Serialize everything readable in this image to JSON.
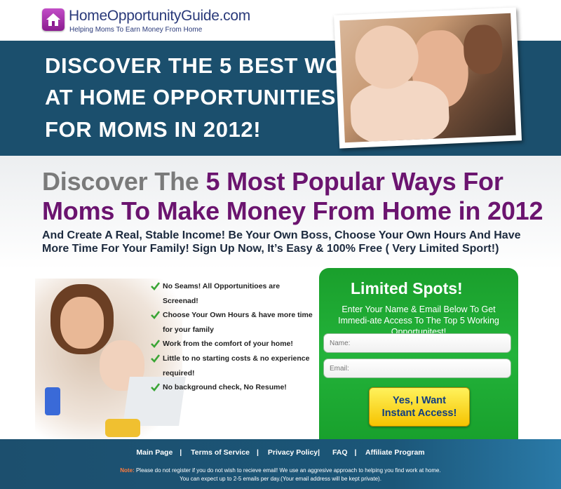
{
  "header": {
    "logo_name": "HomeOpportunityGuide",
    "logo_domain": ".com",
    "tagline": "Helping Moms To Earn Money From Home",
    "icon": "house-icon"
  },
  "hero": {
    "line1": "DISCOVER THE 5 BEST WORK",
    "line2": "AT HOME OPPORTUNITIES",
    "line3": "FOR MOMS IN 2012!"
  },
  "main": {
    "headline_gray": "Discover The ",
    "headline_purple": "5 Most Popular Ways For",
    "headline2": "Moms To Make Money From Home in 2012",
    "subhead": "And Create A Real, Stable Income! Be Your Own Boss, Choose Your Own Hours And Have More Time For Your Family! Sign Up Now, It’s Easy & 100% Free ( Very Limited Sport!)",
    "benefits": [
      "No Seams! All Opportunitioes are Screenad!",
      "Choose Your Own Hours & have more time for your family",
      "Work from the comfort of your home!",
      "Little to no starting costs & no experience required!",
      "No background check, No Resume!"
    ]
  },
  "form": {
    "title": "Limited Spots!",
    "description": "Enter Your Name & Email Below To Get Immedi-ate Access To The Top 5 Working Opportunitest!",
    "name_placeholder": "Name:",
    "email_placeholder": "Email:",
    "cta_line1": "Yes, I Want",
    "cta_line2": "Instant Access!"
  },
  "footer": {
    "links": [
      "Main Page",
      "Terms of Service",
      "Privacy Policy|",
      "FAQ",
      "Affiliate Program"
    ],
    "note_label": "Note:",
    "note_text": "Please do not register if you do not wish to recieve email! We use an aggresive approach to helping you find work at home.",
    "note_text2": "You can expect up to 2-5 emails per day.(Your email address will be kept private)."
  },
  "colors": {
    "hero_bg": "#1b4f6d",
    "purple": "#6b146f",
    "form_green": "#23b33a",
    "cta_yellow": "#f6c300"
  }
}
